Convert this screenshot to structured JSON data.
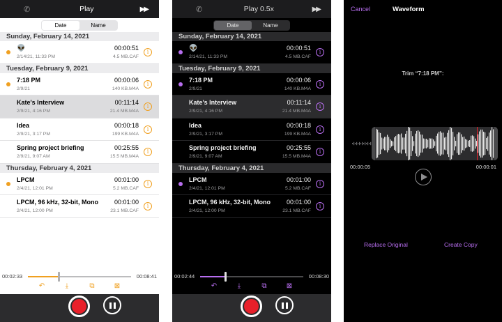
{
  "light": {
    "topbar": {
      "title": "Play"
    },
    "segments": [
      "Date",
      "Name"
    ],
    "sections": [
      {
        "header": "Sunday, February 14, 2021",
        "rows": [
          {
            "name": "👽",
            "date": "2/14/21, 11:33 PM",
            "duration": "00:00:51",
            "size": "4.5 MB.CAF",
            "dot": true,
            "selected": false
          }
        ]
      },
      {
        "header": "Tuesday, February 9, 2021",
        "rows": [
          {
            "name": "7:18 PM",
            "date": "2/9/21",
            "duration": "00:00:06",
            "size": "140 KB.M4A",
            "dot": true,
            "selected": false
          },
          {
            "name": "Kate's Interview",
            "date": "2/9/21, 4:16 PM",
            "duration": "00:11:14",
            "size": "21.4 MB.M4A",
            "dot": false,
            "selected": true
          },
          {
            "name": "Idea",
            "date": "2/9/21, 3:17 PM",
            "duration": "00:00:18",
            "size": "199 KB.M4A",
            "dot": false,
            "selected": false
          },
          {
            "name": "Spring project briefing",
            "date": "2/9/21, 9:07 AM",
            "duration": "00:25:55",
            "size": "15.5 MB.M4A",
            "dot": false,
            "selected": false
          }
        ]
      },
      {
        "header": "Thursday, February 4, 2021",
        "rows": [
          {
            "name": "LPCM",
            "date": "2/4/21, 12:01 PM",
            "duration": "00:01:00",
            "size": "5.2 MB.CAF",
            "dot": true,
            "selected": false
          },
          {
            "name": "LPCM, 96 kHz, 32-bit, Mono",
            "date": "2/4/21, 12:00 PM",
            "duration": "00:01:00",
            "size": "23.1 MB.CAF",
            "dot": false,
            "selected": false
          }
        ]
      }
    ],
    "player": {
      "elapsed": "00:02:33",
      "total": "00:08:41",
      "progress": 0.294
    }
  },
  "dark": {
    "topbar": {
      "title": "Play 0.5x"
    },
    "segments": [
      "Date",
      "Name"
    ],
    "sections": [
      {
        "header": "Sunday, February 14, 2021",
        "rows": [
          {
            "name": "👽",
            "date": "2/14/21, 11:33 PM",
            "duration": "00:00:51",
            "size": "4.5 MB.CAF",
            "dot": true,
            "selected": false
          }
        ]
      },
      {
        "header": "Tuesday, February 9, 2021",
        "rows": [
          {
            "name": "7:18 PM",
            "date": "2/9/21",
            "duration": "00:00:06",
            "size": "140 KB.M4A",
            "dot": true,
            "selected": false
          },
          {
            "name": "Kate's Interview",
            "date": "2/9/21, 4:16 PM",
            "duration": "00:11:14",
            "size": "21.4 MB.M4A",
            "dot": false,
            "selected": true
          },
          {
            "name": "Idea",
            "date": "2/9/21, 3:17 PM",
            "duration": "00:00:18",
            "size": "199 KB.M4A",
            "dot": false,
            "selected": false
          },
          {
            "name": "Spring project briefing",
            "date": "2/9/21, 9:07 AM",
            "duration": "00:25:55",
            "size": "15.5 MB.M4A",
            "dot": false,
            "selected": false
          }
        ]
      },
      {
        "header": "Thursday, February 4, 2021",
        "rows": [
          {
            "name": "LPCM",
            "date": "2/4/21, 12:01 PM",
            "duration": "00:01:00",
            "size": "5.2 MB.CAF",
            "dot": true,
            "selected": false
          },
          {
            "name": "LPCM, 96 kHz, 32-bit, Mono",
            "date": "2/4/21, 12:00 PM",
            "duration": "00:01:00",
            "size": "23.1 MB.CAF",
            "dot": false,
            "selected": false
          }
        ]
      }
    ],
    "player": {
      "elapsed": "00:02:44",
      "total": "00:08:30",
      "progress": 0.245
    }
  },
  "waveform": {
    "cancel": "Cancel",
    "title": "Waveform",
    "trim_label": "Trim “7:18 PM”:",
    "start_time": "00:00:05",
    "end_time": "00:00:01",
    "replace_label": "Replace Original",
    "copy_label": "Create Copy"
  },
  "colors": {
    "accent_light": "#f0a020",
    "accent_dark": "#b86ef0",
    "record": "#e8202a"
  },
  "icons": {
    "toolbar": [
      "share-icon",
      "download-icon",
      "duplicate-icon",
      "archive-icon"
    ]
  }
}
